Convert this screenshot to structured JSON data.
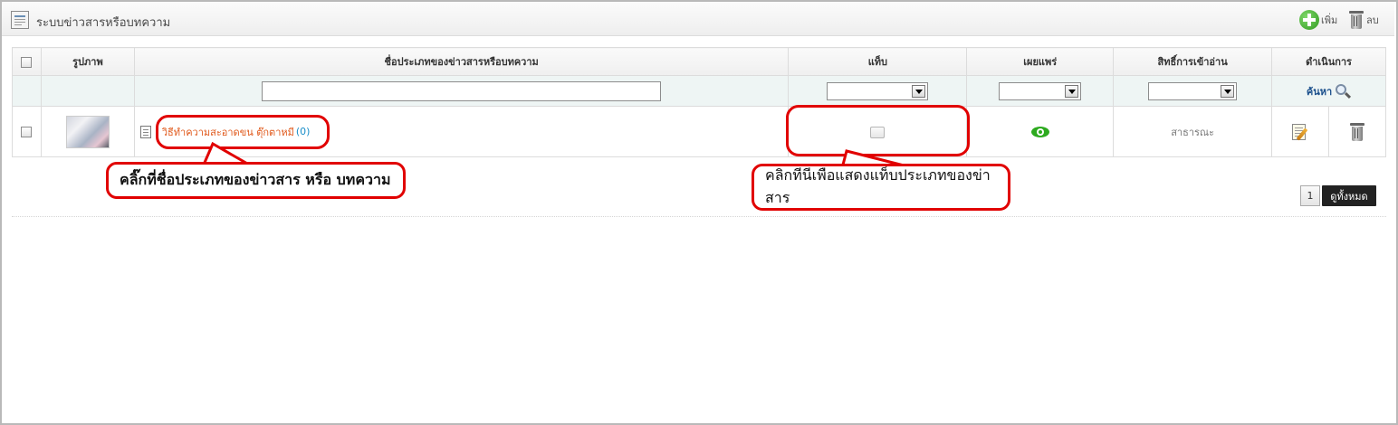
{
  "panel": {
    "title": "ระบบข่าวสารหรือบทความ",
    "add_label": "เพิ่ม",
    "delete_label": "ลบ"
  },
  "table": {
    "headers": {
      "image": "รูปภาพ",
      "name": "ชื่อประเภทของข่าวสารหรือบทความ",
      "tab": "แท็บ",
      "publish": "เผยแพร่",
      "access": "สิทธิ์การเข้าอ่าน",
      "actions": "ดำเนินการ"
    },
    "filter": {
      "search_label": "ค้นหา"
    },
    "rows": [
      {
        "name": "วิธีทำความสะอาดขน ตุ๊กตาหมี",
        "count": "(0)",
        "access": "สาธารณะ"
      }
    ]
  },
  "pager": {
    "page": "1",
    "view_all_label": "ดูทั้งหมด"
  },
  "annotations": {
    "left_callout": "คลิ๊กที่ชื่อประเภทของข่าวสาร หรือ บทความ",
    "right_callout": "คลิกทีนีเพือแสดงแท็บประเภทของข่าสาร"
  },
  "colors": {
    "callout_border": "#e10000",
    "link": "#e0581a",
    "count": "#1a8ec9",
    "publish_icon": "#2daa1f"
  }
}
